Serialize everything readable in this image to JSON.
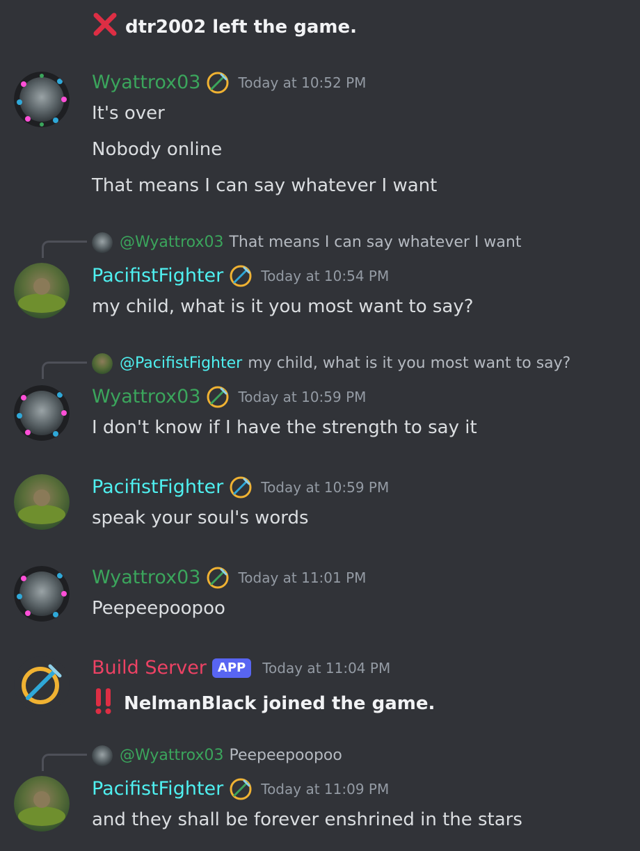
{
  "messages": [
    {
      "type": "system_line",
      "icon": "cross-mark-icon",
      "text": "dtr2002 left the game."
    },
    {
      "type": "message",
      "author": "Wyattrox03",
      "author_color": "#3ba55c",
      "badge": "pickaxe-icon",
      "timestamp": "Today at 10:52 PM",
      "lines": [
        "It's over",
        "Nobody online",
        "That means I can say whatever I want"
      ]
    },
    {
      "type": "reply_message",
      "reply_to": "@Wyattrox03",
      "reply_text": "That means I can say whatever I want",
      "author": "PacifistFighter",
      "author_color": "#4ff0f0",
      "badge": "pickaxe-icon",
      "timestamp": "Today at 10:54 PM",
      "lines": [
        "my child,  what is it you most want to say?"
      ]
    },
    {
      "type": "reply_message",
      "reply_to": "@PacifistFighter",
      "reply_text": "my child,  what is it you most want to say?",
      "author": "Wyattrox03",
      "author_color": "#3ba55c",
      "badge": "pickaxe-icon",
      "timestamp": "Today at 10:59 PM",
      "lines": [
        "I don't know if I have the strength to say it"
      ]
    },
    {
      "type": "message",
      "author": "PacifistFighter",
      "author_color": "#4ff0f0",
      "badge": "pickaxe-icon",
      "timestamp": "Today at 10:59 PM",
      "lines": [
        "speak your soul's words"
      ]
    },
    {
      "type": "message",
      "author": "Wyattrox03",
      "author_color": "#3ba55c",
      "badge": "pickaxe-icon",
      "timestamp": "Today at 11:01 PM",
      "lines": [
        "Peepeepoopoo"
      ]
    },
    {
      "type": "bot_message",
      "author": "Build Server",
      "author_color": "#ed4264",
      "tag": "APP",
      "timestamp": "Today at 11:04 PM",
      "icon": "double-exclamation-icon",
      "lines": [
        "NelmanBlack joined the game."
      ]
    },
    {
      "type": "reply_message",
      "reply_to": "@Wyattrox03",
      "reply_text": "Peepeepoopoo",
      "author": "PacifistFighter",
      "author_color": "#4ff0f0",
      "badge": "pickaxe-icon",
      "timestamp": "Today at 11:09 PM",
      "lines": [
        "and they shall be forever enshrined in the stars"
      ]
    }
  ],
  "colors": {
    "background": "#313338",
    "text": "#dbdee1",
    "timestamp": "#949ba4",
    "app_tag": "#5865f2"
  }
}
